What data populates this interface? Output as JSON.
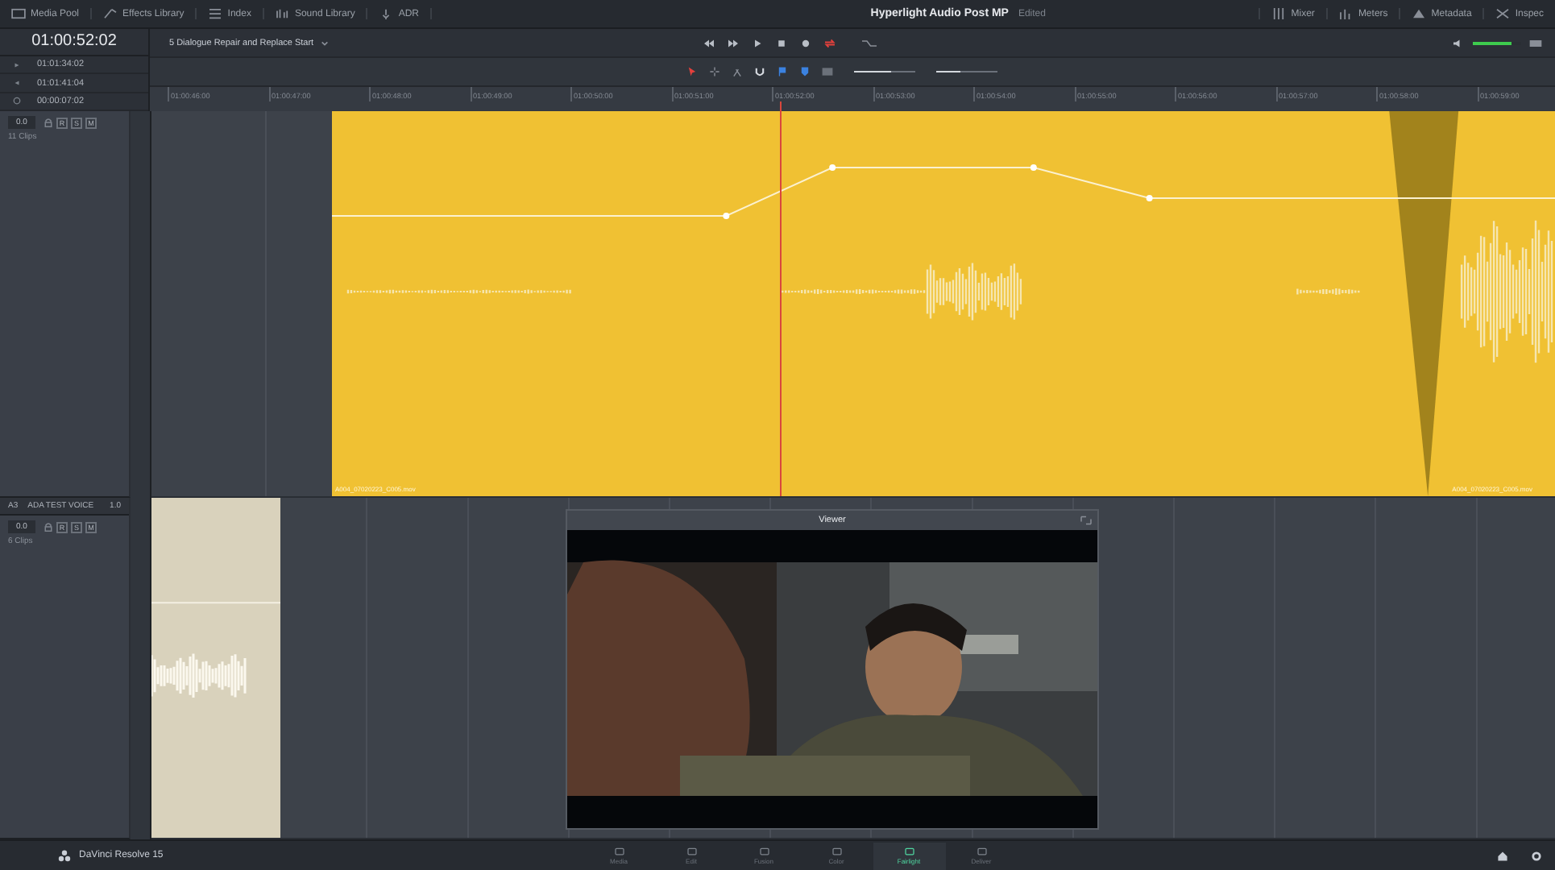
{
  "top_bar": {
    "left_tabs": [
      {
        "label": "Media Pool"
      },
      {
        "label": "Effects Library"
      },
      {
        "label": "Index"
      },
      {
        "label": "Sound Library"
      },
      {
        "label": "ADR"
      }
    ],
    "project_title": "Hyperlight Audio Post MP",
    "project_status": "Edited",
    "right_tabs": [
      {
        "label": "Mixer"
      },
      {
        "label": "Meters"
      },
      {
        "label": "Metadata"
      },
      {
        "label": "Inspec"
      }
    ]
  },
  "timecode": "01:00:52:02",
  "timeline_name": "5 Dialogue Repair and Replace Start",
  "monitor_volume": {
    "level": 0.8
  },
  "marks": [
    {
      "kind": "in",
      "value": "01:01:34:02"
    },
    {
      "kind": "out",
      "value": "01:01:41:04"
    },
    {
      "kind": "duration",
      "value": "00:00:07:02"
    }
  ],
  "zoom_sliders": [
    {
      "level": 0.6
    },
    {
      "level": 0.4
    }
  ],
  "ruler": [
    "01:00:46:00",
    "01:00:47:00",
    "01:00:48:00",
    "01:00:49:00",
    "01:00:50:00",
    "01:00:51:00",
    "01:00:52:00",
    "01:00:53:00",
    "01:00:54:00",
    "01:00:55:00",
    "01:00:56:00",
    "01:00:57:00",
    "01:00:58:00",
    "01:00:59:00"
  ],
  "tracks": [
    {
      "kind": "dialogue",
      "volume": "0.0",
      "buttons": [
        "R",
        "S",
        "M"
      ],
      "clip_count": "11 Clips",
      "clips": [
        {
          "label": "A004_07020223_C005.mov"
        },
        {
          "label": "A004_07020223_C005.mov"
        }
      ]
    },
    {
      "kind": "voice",
      "id": "A3",
      "name": "ADA TEST VOICE",
      "gain": "1.0",
      "volume": "0.0",
      "buttons": [
        "R",
        "S",
        "M"
      ],
      "clip_count": "6 Clips"
    }
  ],
  "viewer": {
    "title": "Viewer",
    "kind": "picture"
  },
  "bottom_bar": {
    "app_name": "DaVinci Resolve 15",
    "pages": [
      {
        "label": "Media",
        "selected": false
      },
      {
        "label": "Edit",
        "selected": false
      },
      {
        "label": "Fusion",
        "selected": false
      },
      {
        "label": "Color",
        "selected": false
      },
      {
        "label": "Fairlight",
        "selected": true
      },
      {
        "label": "Deliver",
        "selected": false
      }
    ]
  }
}
